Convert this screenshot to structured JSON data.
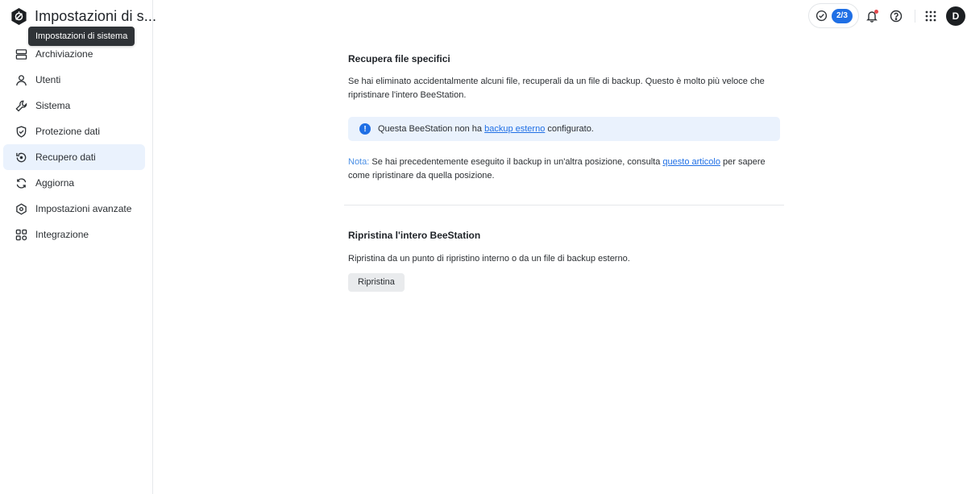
{
  "app": {
    "title": "Impostazioni di s...",
    "tooltip": "Impostazioni di sistema"
  },
  "sidebar": {
    "items": [
      {
        "label": "Archiviazione",
        "icon": "storage-icon",
        "active": false
      },
      {
        "label": "Utenti",
        "icon": "user-icon",
        "active": false
      },
      {
        "label": "Sistema",
        "icon": "wrench-icon",
        "active": false
      },
      {
        "label": "Protezione dati",
        "icon": "shield-icon",
        "active": false
      },
      {
        "label": "Recupero dati",
        "icon": "restore-icon",
        "active": true
      },
      {
        "label": "Aggiorna",
        "icon": "refresh-icon",
        "active": false
      },
      {
        "label": "Impostazioni avanzate",
        "icon": "advanced-settings-icon",
        "active": false
      },
      {
        "label": "Integrazione",
        "icon": "grid-icon",
        "active": false
      }
    ]
  },
  "topbar": {
    "task_count": "2/3",
    "avatar_initial": "D"
  },
  "recover_files": {
    "title": "Recupera file specifici",
    "description": "Se hai eliminato accidentalmente alcuni file, recuperali da un file di backup. Questo è molto più veloce che ripristinare l'intero BeeStation.",
    "info_prefix": "Questa BeeStation non ha ",
    "info_link": "backup esterno",
    "info_suffix": " configurato.",
    "note_label": "Nota:",
    "note_text_before": " Se hai precedentemente eseguito il backup in un'altra posizione, consulta ",
    "note_link": "questo articolo",
    "note_text_after": " per sapere come ripristinare da quella posizione."
  },
  "restore_all": {
    "title": "Ripristina l'intero BeeStation",
    "description": "Ripristina da un punto di ripristino interno o da un file di backup esterno.",
    "button_label": "Ripristina"
  },
  "colors": {
    "accent": "#1f6fe5",
    "active_bg": "#eaf2fd",
    "notification_dot": "#e5484d"
  }
}
